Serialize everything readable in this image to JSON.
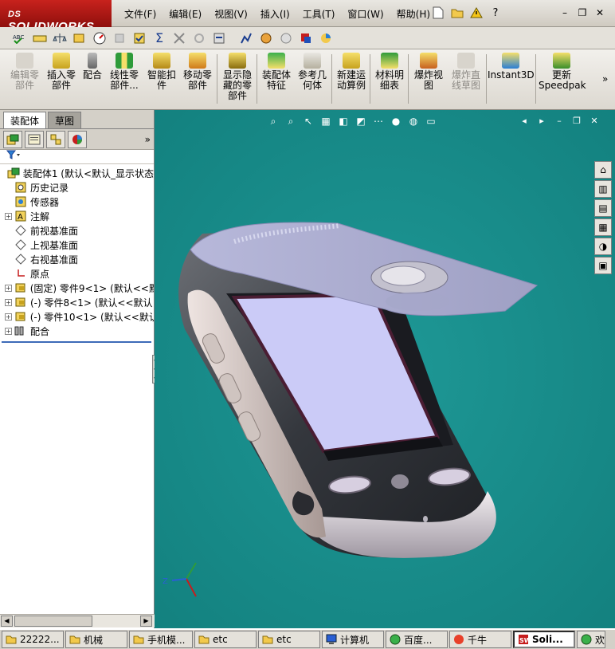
{
  "app": {
    "brand": "SOLIDWORKS",
    "brand_prefix": "DS"
  },
  "menus": [
    "文件(F)",
    "编辑(E)",
    "视图(V)",
    "插入(I)",
    "工具(T)",
    "窗口(W)",
    "帮助(H)"
  ],
  "std_tools": [
    {
      "icon": "new-document-icon"
    },
    {
      "icon": "open-folder-icon"
    },
    {
      "icon": "warning-icon"
    },
    {
      "icon": "help-icon"
    }
  ],
  "window_controls": [
    {
      "icon": "minimize-icon",
      "glyph": "–"
    },
    {
      "icon": "restore-icon",
      "glyph": "❐"
    },
    {
      "icon": "close-icon",
      "glyph": "✕"
    }
  ],
  "commands": [
    {
      "label": "编辑零\n部件",
      "icon": "edit-component-icon",
      "enabled": false
    },
    {
      "label": "插入零\n部件",
      "icon": "insert-component-icon",
      "enabled": true
    },
    {
      "label": "配合",
      "icon": "mate-icon",
      "enabled": true
    },
    {
      "label": "线性零\n部件...",
      "icon": "linear-pattern-icon",
      "enabled": true
    },
    {
      "label": "智能扣\n件",
      "icon": "smart-fasteners-icon",
      "enabled": true
    },
    {
      "label": "移动零\n部件",
      "icon": "move-component-icon",
      "enabled": true
    },
    {
      "label": "显示隐\n藏的零\n部件",
      "icon": "show-hidden-icon",
      "enabled": true
    },
    {
      "label": "装配体\n特征",
      "icon": "assembly-features-icon",
      "enabled": true
    },
    {
      "label": "参考几\n何体",
      "icon": "reference-geometry-icon",
      "enabled": true
    },
    {
      "label": "新建运\n动算例",
      "icon": "motion-study-icon",
      "enabled": true
    },
    {
      "label": "材料明\n细表",
      "icon": "bom-icon",
      "enabled": true
    },
    {
      "label": "爆炸视\n图",
      "icon": "exploded-view-icon",
      "enabled": true
    },
    {
      "label": "爆炸直\n线草图",
      "icon": "explode-line-sketch-icon",
      "enabled": false
    },
    {
      "label": "Instant3D",
      "icon": "instant3d-icon",
      "enabled": true
    },
    {
      "label": "更新\nSpeedpak",
      "icon": "speedpak-icon",
      "enabled": true
    }
  ],
  "panel": {
    "tabs": [
      {
        "label": "装配体",
        "active": true
      },
      {
        "label": "草图",
        "active": false
      }
    ],
    "tree": [
      {
        "label": "装配体1  (默认<默认_显示状态",
        "icon": "assembly-icon",
        "expander": "",
        "indent": 0
      },
      {
        "label": "历史记录",
        "icon": "history-icon",
        "expander": "",
        "indent": 1
      },
      {
        "label": "传感器",
        "icon": "sensor-icon",
        "expander": "",
        "indent": 1
      },
      {
        "label": "注解",
        "icon": "annotation-icon",
        "expander": "+",
        "indent": 1
      },
      {
        "label": "前视基准面",
        "icon": "plane-icon",
        "expander": "",
        "indent": 1
      },
      {
        "label": "上视基准面",
        "icon": "plane-icon",
        "expander": "",
        "indent": 1
      },
      {
        "label": "右视基准面",
        "icon": "plane-icon",
        "expander": "",
        "indent": 1
      },
      {
        "label": "原点",
        "icon": "origin-icon",
        "expander": "",
        "indent": 1
      },
      {
        "label": "(固定) 零件9<1> (默认<<默",
        "icon": "part-icon",
        "expander": "+",
        "indent": 1
      },
      {
        "label": "(-) 零件8<1> (默认<<默认",
        "icon": "part-icon",
        "expander": "+",
        "indent": 1
      },
      {
        "label": "(-) 零件10<1> (默认<<默认",
        "icon": "part-icon",
        "expander": "+",
        "indent": 1
      },
      {
        "label": "配合",
        "icon": "mates-folder-icon",
        "expander": "+",
        "indent": 1
      }
    ]
  },
  "viewport": {
    "triad_axis": "Z"
  },
  "taskbar": [
    {
      "label": "22222...",
      "icon": "folder-icon"
    },
    {
      "label": "机械",
      "icon": "folder-icon"
    },
    {
      "label": "手机模...",
      "icon": "folder-icon"
    },
    {
      "label": "etc",
      "icon": "folder-icon"
    },
    {
      "label": "etc",
      "icon": "folder-icon"
    },
    {
      "label": "计算机",
      "icon": "computer-icon"
    },
    {
      "label": "百度...",
      "icon": "browser-icon"
    },
    {
      "label": "千牛",
      "icon": "chat-icon"
    },
    {
      "label": "Soli...",
      "icon": "solidworks-icon",
      "active": true
    },
    {
      "label": "欢",
      "icon": "browser-icon"
    }
  ],
  "colors": {
    "viewport_bg": "#13817f",
    "brand_red": "#b01a15",
    "tree_separator": "#3d6bb8"
  }
}
